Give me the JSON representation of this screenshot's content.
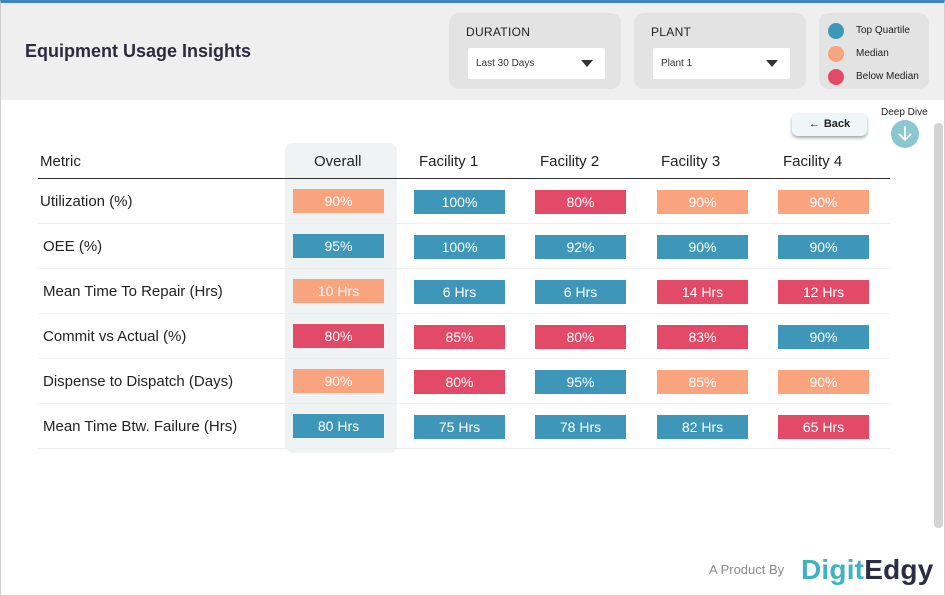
{
  "header": {
    "title": "Equipment Usage Insights"
  },
  "filters": {
    "duration": {
      "label": "DURATION",
      "value": "Last 30 Days"
    },
    "plant": {
      "label": "PLANT",
      "value": "Plant 1"
    }
  },
  "legend": [
    {
      "label": "Top Quartile",
      "color": "#3e97b8"
    },
    {
      "label": "Median",
      "color": "#f9a37f"
    },
    {
      "label": "Below Median",
      "color": "#e34a67"
    }
  ],
  "actions": {
    "back_label": "Back",
    "deep_dive_label": "Deep Dive"
  },
  "table": {
    "columns": [
      "Metric",
      "Overall",
      "Facility 1",
      "Facility 2",
      "Facility 3",
      "Facility 4"
    ],
    "rows": [
      {
        "metric": "Utilization (%)",
        "cells": [
          {
            "value": "90%",
            "tier": "median"
          },
          {
            "value": "100%",
            "tier": "top"
          },
          {
            "value": "80%",
            "tier": "below"
          },
          {
            "value": "90%",
            "tier": "median"
          },
          {
            "value": "90%",
            "tier": "median"
          }
        ]
      },
      {
        "metric": "OEE (%)",
        "cells": [
          {
            "value": "95%",
            "tier": "top"
          },
          {
            "value": "100%",
            "tier": "top"
          },
          {
            "value": "92%",
            "tier": "top"
          },
          {
            "value": "90%",
            "tier": "top"
          },
          {
            "value": "90%",
            "tier": "top"
          }
        ]
      },
      {
        "metric": "Mean Time To Repair (Hrs)",
        "cells": [
          {
            "value": "10 Hrs",
            "tier": "median"
          },
          {
            "value": "6 Hrs",
            "tier": "top"
          },
          {
            "value": "6 Hrs",
            "tier": "top"
          },
          {
            "value": "14 Hrs",
            "tier": "below"
          },
          {
            "value": "12 Hrs",
            "tier": "below"
          }
        ]
      },
      {
        "metric": "Commit vs Actual (%)",
        "cells": [
          {
            "value": "80%",
            "tier": "below"
          },
          {
            "value": "85%",
            "tier": "below"
          },
          {
            "value": "80%",
            "tier": "below"
          },
          {
            "value": "83%",
            "tier": "below"
          },
          {
            "value": "90%",
            "tier": "top"
          }
        ]
      },
      {
        "metric": "Dispense to Dispatch (Days)",
        "cells": [
          {
            "value": "90%",
            "tier": "median"
          },
          {
            "value": "80%",
            "tier": "below"
          },
          {
            "value": "95%",
            "tier": "top"
          },
          {
            "value": "85%",
            "tier": "median"
          },
          {
            "value": "90%",
            "tier": "median"
          }
        ]
      },
      {
        "metric": "Mean Time Btw. Failure (Hrs)",
        "cells": [
          {
            "value": "80 Hrs",
            "tier": "top"
          },
          {
            "value": "75 Hrs",
            "tier": "top"
          },
          {
            "value": "78 Hrs",
            "tier": "top"
          },
          {
            "value": "82 Hrs",
            "tier": "top"
          },
          {
            "value": "65 Hrs",
            "tier": "below"
          }
        ]
      }
    ]
  },
  "footer": {
    "by_text": "A Product By",
    "brand_part1": "Digit",
    "brand_part2": "Edgy"
  },
  "icons": {
    "back": "arrow-left-icon",
    "deep_dive": "arrow-down-circle-icon",
    "dropdown": "caret-down-icon"
  }
}
